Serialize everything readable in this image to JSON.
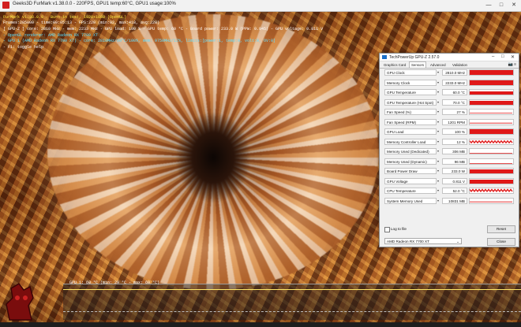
{
  "window": {
    "title": "Geeks3D FurMark v1.38.0.0 - 220FPS, GPU1 temp:60°C, GPU1 usage:100%",
    "minimize": "—",
    "maximize": "□",
    "close": "✕"
  },
  "overlay": {
    "line1": "FurMark v1.38.0.0 - Burn-in test, 1920x1080 (OpenGL)",
    "line2": "Frames:285000 - time:00:05:13 - FPS:220 (min:92, max:418, avg:220)",
    "line3": "[ GPU-Z ] core: 2810 MHz - mem: 2233 MHz - GPU load: 100 % - GPU temp: 60 °C - Board power: 233.0 W (PPW: 0.945) - GPU voltage: 0.811 V",
    "line4": "- OpenGL renderer: AMD Radeon RX 7700 XT",
    "line5": "- GPU 1 (AMD Radeon RX 7700 XT) - core: 2810MHz/60°C/100%, mem: 9750MHz/12%, limits:[power:1, temp:0, volt:0, OV:0]",
    "line6": "- F1: toggle help"
  },
  "osd": {
    "graph_label": "GPU 1: 60 °C (min: 29 °C - max: 60 °C)",
    "colors": {
      "temp_line": "#ffe86a"
    }
  },
  "gpuz": {
    "title": "TechPowerUp GPU-Z 2.57.0",
    "tabs": [
      "Graphics Card",
      "Sensors",
      "Advanced",
      "Validation"
    ],
    "active_tab": "Sensors",
    "tools": "📷 ≡",
    "sensors": [
      {
        "label": "GPU Clock",
        "value": "2810.0 MHz",
        "level": 0.95,
        "graph": "full"
      },
      {
        "label": "Memory Clock",
        "value": "2233.0 MHz",
        "level": 0.95,
        "graph": "full"
      },
      {
        "label": "GPU Temperature",
        "value": "60.0 °C",
        "level": 0.6,
        "graph": "full"
      },
      {
        "label": "GPU Temperature (Hot Spot)",
        "value": "70.0 °C",
        "level": 0.7,
        "graph": "full"
      },
      {
        "label": "Fan Speed (%)",
        "value": "27 %",
        "level": 0.27,
        "graph": "line"
      },
      {
        "label": "Fan Speed (RPM)",
        "value": "1201 RPM",
        "level": 0.3,
        "graph": "line"
      },
      {
        "label": "GPU Load",
        "value": "100 %",
        "level": 1.0,
        "graph": "full"
      },
      {
        "label": "Memory Controller Load",
        "value": "12 %",
        "level": 0.5,
        "graph": "noisy"
      },
      {
        "label": "Memory Used (Dedicated)",
        "value": "306 MB",
        "level": 0.03,
        "graph": "line"
      },
      {
        "label": "Memory Used (Dynamic)",
        "value": "96 MB",
        "level": 0.02,
        "graph": "line"
      },
      {
        "label": "Board Power Draw",
        "value": "233.0 W",
        "level": 0.9,
        "graph": "full"
      },
      {
        "label": "GPU Voltage",
        "value": "0.811 V",
        "level": 0.75,
        "graph": "full"
      },
      {
        "label": "CPU Temperature",
        "value": "52.0 °C",
        "level": 0.55,
        "graph": "noisy"
      },
      {
        "label": "System Memory Used",
        "value": "10831 MB",
        "level": 0.3,
        "graph": "line"
      }
    ],
    "log_to_file": "Log to file",
    "reset": "Reset",
    "device": "AMD Radeon RX 7700 XT",
    "close": "Close",
    "colors": {
      "graph": "#e01818"
    }
  }
}
